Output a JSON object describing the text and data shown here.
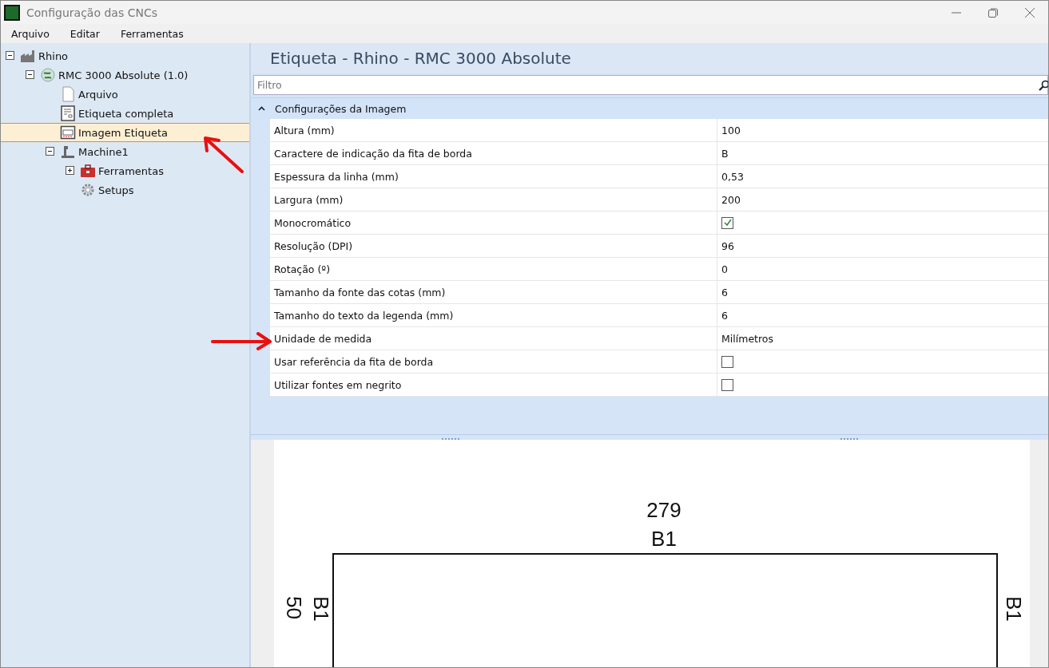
{
  "window": {
    "title": "Configuração das CNCs"
  },
  "menu": [
    "Arquivo",
    "Editar",
    "Ferramentas"
  ],
  "tree": [
    {
      "label": "Rhino",
      "kind": "factory",
      "expanded": true,
      "selected": false,
      "children": [
        {
          "label": "RMC 3000 Absolute (1.0)",
          "kind": "globe",
          "expanded": true,
          "selected": false,
          "children": [
            {
              "label": "Arquivo",
              "kind": "page",
              "selected": false
            },
            {
              "label": "Etiqueta completa",
              "kind": "label",
              "selected": false
            },
            {
              "label": "Imagem Etiqueta",
              "kind": "image",
              "selected": true
            },
            {
              "label": "Machine1",
              "kind": "machine",
              "expanded": true,
              "selected": false,
              "children": [
                {
                  "label": "Ferramentas",
                  "kind": "toolbox",
                  "expanded": false,
                  "selected": false
                },
                {
                  "label": "Setups",
                  "kind": "gear",
                  "selected": false
                }
              ]
            }
          ]
        }
      ]
    }
  ],
  "panel": {
    "title": "Etiqueta - Rhino - RMC 3000 Absolute",
    "filter": {
      "placeholder": "Filtro"
    },
    "category": {
      "label": "Configurações da Imagem",
      "expanded": true
    },
    "properties": [
      {
        "name": "Altura (mm)",
        "kind": "text",
        "value": "100"
      },
      {
        "name": "Caractere de indicação da fita de borda",
        "kind": "text",
        "value": "B"
      },
      {
        "name": "Espessura da linha (mm)",
        "kind": "text",
        "value": "0,53"
      },
      {
        "name": "Largura (mm)",
        "kind": "text",
        "value": "200"
      },
      {
        "name": "Monocromático",
        "kind": "checkbox",
        "checked": true
      },
      {
        "name": "Resolução (DPI)",
        "kind": "text",
        "value": "96"
      },
      {
        "name": "Rotação (º)",
        "kind": "text",
        "value": "0"
      },
      {
        "name": "Tamanho da fonte das cotas (mm)",
        "kind": "text",
        "value": "6"
      },
      {
        "name": "Tamanho do texto da legenda (mm)",
        "kind": "text",
        "value": "6"
      },
      {
        "name": "Unidade de medida",
        "kind": "text",
        "value": "Milímetros"
      },
      {
        "name": "Usar referência da fita de borda",
        "kind": "checkbox",
        "checked": false
      },
      {
        "name": "Utilizar fontes em negrito",
        "kind": "checkbox",
        "checked": false
      }
    ]
  },
  "preview": {
    "top_dimension": "279",
    "top_edge": "B1",
    "left_dimension": "50",
    "left_edge": "B1",
    "right_edge": "B1"
  }
}
